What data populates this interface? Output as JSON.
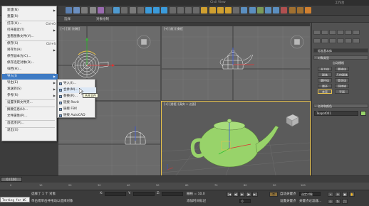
{
  "app": {
    "title_center": "Civil View",
    "title_right": "工作台",
    "title_left": "无标题"
  },
  "colors": {
    "viewport_bg": "#6b6b6b",
    "perspective_bg": "#5b5b5b",
    "teapot": "#98d36a",
    "active_border": "#e8c24a",
    "menu_highlight": "#3e7bc4",
    "x_axis": "#e03030",
    "y_axis": "#30c030",
    "z_axis": "#3050e0"
  },
  "toolbar": {
    "icons": [
      "undo-icon",
      "redo-icon",
      "link-icon",
      "unlink-icon",
      "bind-space-warp-icon",
      "select-filter-icon",
      "select-object-icon",
      "select-by-name-icon",
      "rectangular-region-icon",
      "window-crossing-icon",
      "select-move-icon",
      "select-rotate-icon",
      "select-scale-icon",
      "reference-coordinate-icon",
      "pivot-icon",
      "manipulate-icon",
      "keyboard-shortcut-icon",
      "snap-toggle-icon",
      "angle-snap-icon",
      "percent-snap-icon",
      "spinner-snap-icon",
      "named-selection-icon",
      "mirror-icon",
      "align-icon",
      "layer-manager-icon",
      "curve-editor-icon",
      "schematic-view-icon",
      "material-editor-icon",
      "render-setup-icon",
      "render-frame-icon",
      "render-icon"
    ]
  },
  "tabs": [
    "选择",
    "对象绘制"
  ],
  "viewports": {
    "top_left": "[+] [顶] [线框]",
    "top_right": "[+] [前] [线框]",
    "bottom_left": "[+] [左] [线框]",
    "bottom_right": "[+] [透视] [真实 + 边面]"
  },
  "file_menu": {
    "items": [
      {
        "label": "新建(N)",
        "shortcut": "",
        "submenu": true
      },
      {
        "label": "重置(R)",
        "shortcut": "",
        "submenu": false
      },
      {
        "label": "打开(O)...",
        "shortcut": "Ctrl+O",
        "submenu": false
      },
      {
        "label": "打开最近(T)",
        "shortcut": "",
        "submenu": true
      },
      {
        "label": "查看图像文件(V)...",
        "shortcut": "",
        "submenu": false
      },
      {
        "label": "保存(S)",
        "shortcut": "Ctrl+S",
        "submenu": false
      },
      {
        "label": "另存为(A)",
        "shortcut": "",
        "submenu": true
      },
      {
        "label": "保存副本为(C)...",
        "shortcut": "",
        "submenu": false
      },
      {
        "label": "保存选定对象(D)...",
        "shortcut": "",
        "submenu": false
      },
      {
        "label": "归档(H)...",
        "shortcut": "",
        "submenu": false
      },
      {
        "label": "导入(I)",
        "shortcut": "",
        "submenu": true
      },
      {
        "label": "导出(E)",
        "shortcut": "",
        "submenu": true
      },
      {
        "label": "发送到(S)",
        "shortcut": "",
        "submenu": true
      },
      {
        "label": "参考(R)",
        "shortcut": "",
        "submenu": true
      },
      {
        "label": "设置项目文件夹...",
        "shortcut": "",
        "submenu": false
      },
      {
        "label": "摘要信息(U)...",
        "shortcut": "",
        "submenu": false
      },
      {
        "label": "文件属性(P)...",
        "shortcut": "",
        "submenu": false
      },
      {
        "label": "首选项(P)...",
        "shortcut": "",
        "submenu": false
      },
      {
        "label": "退出(X)",
        "shortcut": "",
        "submenu": false
      }
    ],
    "highlighted": "导入(I)"
  },
  "import_submenu": {
    "items": [
      "导入(I)...",
      "合并(M)...",
      "替换(R)...",
      "链接 Revit",
      "链接 FBX",
      "链接 AutoCAD"
    ],
    "hovered": "合并(M)...",
    "tooltip": "合并文件"
  },
  "command_panel": {
    "dropdown": "标准基本体",
    "object_type_title": "对象类型",
    "auto_grid": "自动栅格",
    "objects": [
      "长方体",
      "圆锥体",
      "球体",
      "几何球体",
      "圆柱体",
      "管状体",
      "圆环",
      "四棱锥",
      "茶壶",
      "平面"
    ],
    "name_color_title": "名称和颜色",
    "object_name": "Teapot001"
  },
  "time_slider": {
    "label": "0 / 100",
    "ticks": [
      "0",
      "10",
      "20",
      "30",
      "40",
      "50",
      "60",
      "70",
      "80",
      "90",
      "100"
    ]
  },
  "status": {
    "selection": "选择了 1 个 对象",
    "prompt": "单击或单击并拖动以选择对象",
    "x_label": "X:",
    "y_label": "Y:",
    "z_label": "Z:",
    "x_value": "",
    "y_value": "",
    "z_value": "",
    "grid": "栅格 = 10.0",
    "add_time_tag": "添加时间标记",
    "auto_key": "自动关键点",
    "set_key": "设置关键点",
    "selected_object": "选定对象",
    "key_filters": "关键点过滤器...",
    "frame": "0",
    "listener": "Testing for WG"
  }
}
